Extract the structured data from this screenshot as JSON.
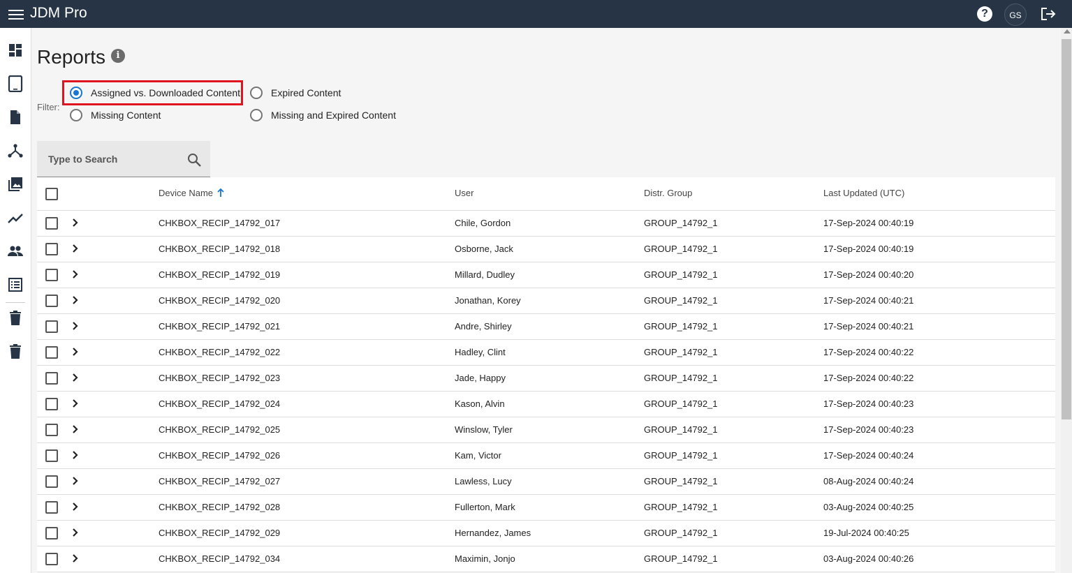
{
  "app": {
    "title": "JDM Pro",
    "avatar_initials": "GS",
    "help_icon": "help-icon",
    "logout_icon": "logout-icon"
  },
  "sidebar": {
    "items": [
      {
        "name": "dashboard-icon"
      },
      {
        "name": "device-tablet-icon"
      },
      {
        "name": "document-icon"
      },
      {
        "name": "hierarchy-icon"
      },
      {
        "name": "media-library-icon"
      },
      {
        "name": "analytics-icon"
      },
      {
        "name": "users-icon"
      },
      {
        "name": "list-icon"
      },
      {
        "name": "trash-icon"
      },
      {
        "name": "trash-icon"
      }
    ]
  },
  "page": {
    "title": "Reports"
  },
  "filter": {
    "label": "Filter:",
    "options": [
      {
        "label": "Assigned vs. Downloaded Content",
        "checked": true
      },
      {
        "label": "Expired Content",
        "checked": false
      },
      {
        "label": "Missing Content",
        "checked": false
      },
      {
        "label": "Missing and Expired Content",
        "checked": false
      }
    ]
  },
  "search": {
    "placeholder": "Type to Search"
  },
  "table": {
    "headers": {
      "device_name": "Device Name",
      "user": "User",
      "group": "Distr. Group",
      "updated": "Last Updated (UTC)"
    },
    "sort": {
      "column": "device_name",
      "direction": "ascending"
    },
    "rows": [
      {
        "device": "CHKBOX_RECIP_14792_017",
        "user": "Chile, Gordon",
        "group": "GROUP_14792_1",
        "updated": "17-Sep-2024 00:40:19"
      },
      {
        "device": "CHKBOX_RECIP_14792_018",
        "user": "Osborne, Jack",
        "group": "GROUP_14792_1",
        "updated": "17-Sep-2024 00:40:19"
      },
      {
        "device": "CHKBOX_RECIP_14792_019",
        "user": "Millard, Dudley",
        "group": "GROUP_14792_1",
        "updated": "17-Sep-2024 00:40:20"
      },
      {
        "device": "CHKBOX_RECIP_14792_020",
        "user": "Jonathan, Korey",
        "group": "GROUP_14792_1",
        "updated": "17-Sep-2024 00:40:21"
      },
      {
        "device": "CHKBOX_RECIP_14792_021",
        "user": "Andre, Shirley",
        "group": "GROUP_14792_1",
        "updated": "17-Sep-2024 00:40:21"
      },
      {
        "device": "CHKBOX_RECIP_14792_022",
        "user": "Hadley, Clint",
        "group": "GROUP_14792_1",
        "updated": "17-Sep-2024 00:40:22"
      },
      {
        "device": "CHKBOX_RECIP_14792_023",
        "user": "Jade, Happy",
        "group": "GROUP_14792_1",
        "updated": "17-Sep-2024 00:40:22"
      },
      {
        "device": "CHKBOX_RECIP_14792_024",
        "user": "Kason, Alvin",
        "group": "GROUP_14792_1",
        "updated": "17-Sep-2024 00:40:23"
      },
      {
        "device": "CHKBOX_RECIP_14792_025",
        "user": "Winslow, Tyler",
        "group": "GROUP_14792_1",
        "updated": "17-Sep-2024 00:40:23"
      },
      {
        "device": "CHKBOX_RECIP_14792_026",
        "user": "Kam, Victor",
        "group": "GROUP_14792_1",
        "updated": "17-Sep-2024 00:40:24"
      },
      {
        "device": "CHKBOX_RECIP_14792_027",
        "user": "Lawless, Lucy",
        "group": "GROUP_14792_1",
        "updated": "08-Aug-2024 00:40:24"
      },
      {
        "device": "CHKBOX_RECIP_14792_028",
        "user": "Fullerton, Mark",
        "group": "GROUP_14792_1",
        "updated": "03-Aug-2024 00:40:25"
      },
      {
        "device": "CHKBOX_RECIP_14792_029",
        "user": "Hernandez, James",
        "group": "GROUP_14792_1",
        "updated": "19-Jul-2024 00:40:25"
      },
      {
        "device": "CHKBOX_RECIP_14792_034",
        "user": "Maximin, Jonjo",
        "group": "GROUP_14792_1",
        "updated": "03-Aug-2024 00:40:26"
      }
    ]
  }
}
